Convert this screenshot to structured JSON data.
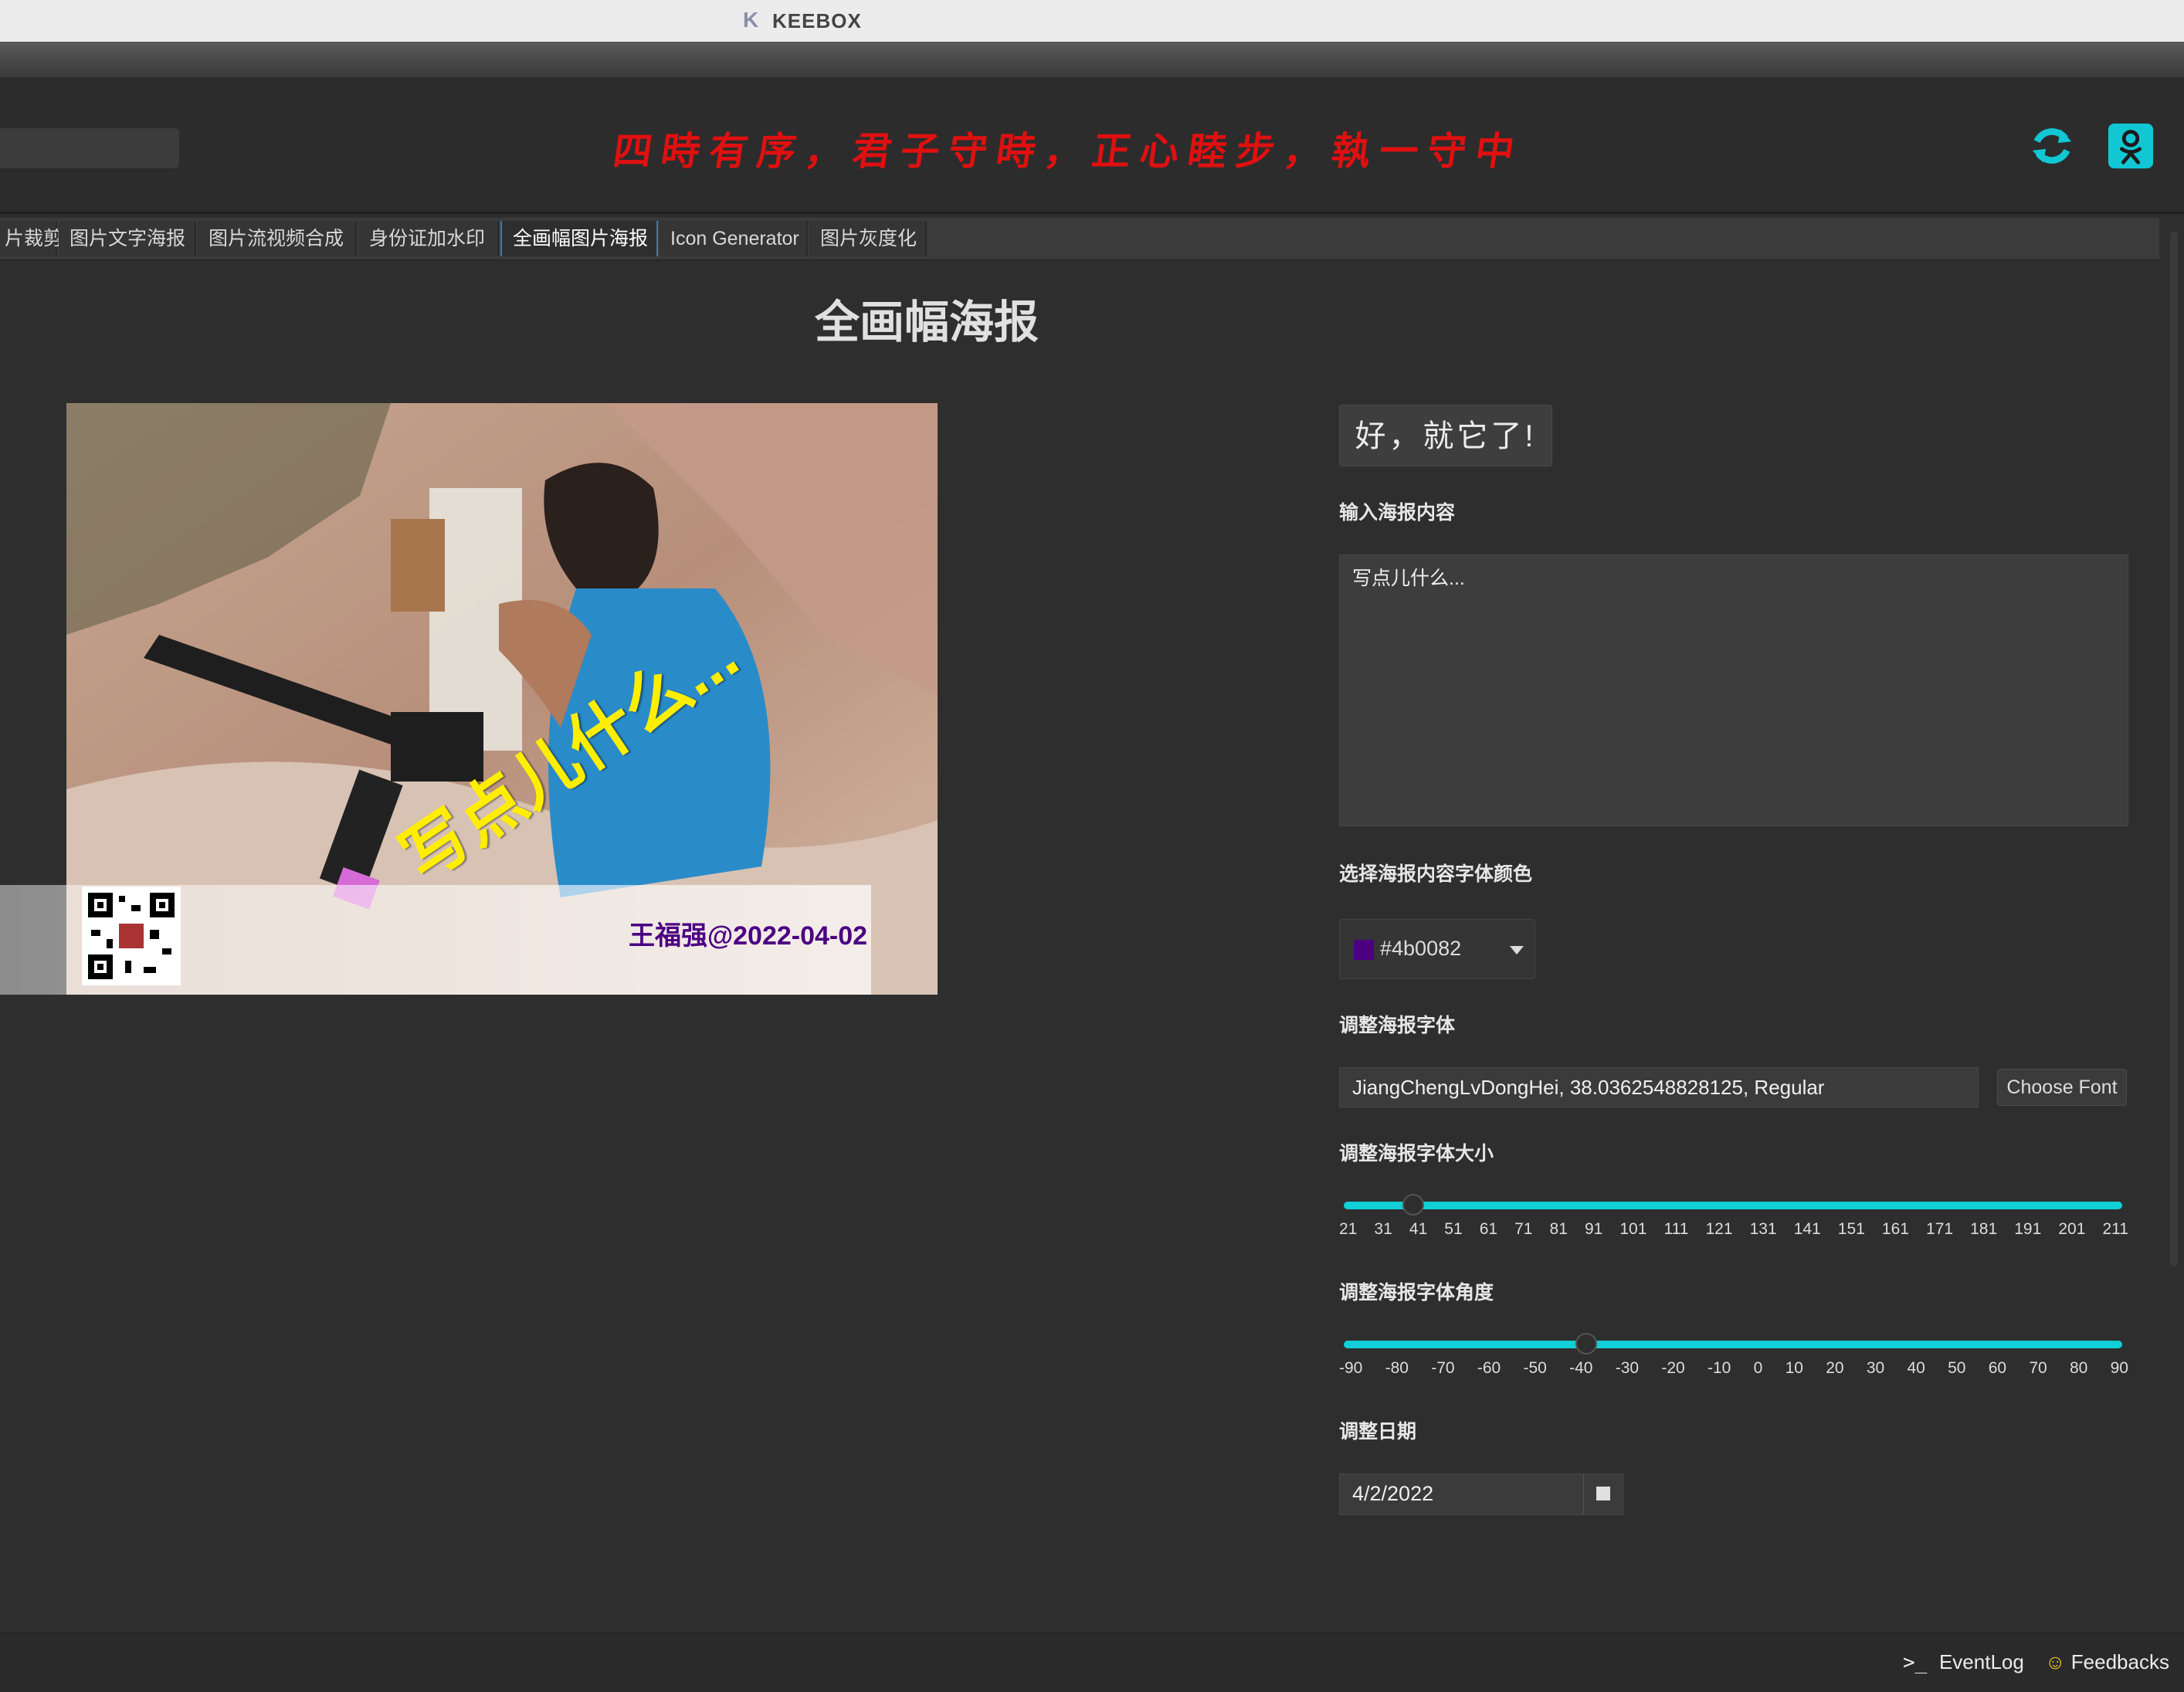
{
  "window": {
    "title": "KEEBOX",
    "logo_glyph": "K"
  },
  "header": {
    "slogan": "四時有序，君子守時，正心睦步，執一守中",
    "accent_color": "#e01010",
    "icons": [
      "refresh-icon",
      "ok-social-icon"
    ],
    "icon_color": "#11c7d4"
  },
  "tabs": [
    {
      "label": "片裁剪"
    },
    {
      "label": "图片文字海报"
    },
    {
      "label": "图片流视频合成"
    },
    {
      "label": "身份证加水印"
    },
    {
      "label": "全画幅图片海报",
      "active": true
    },
    {
      "label": "Icon Generator"
    },
    {
      "label": "图片灰度化"
    }
  ],
  "page": {
    "title": "全画幅海报"
  },
  "poster": {
    "overlay_text": "写点儿什么...",
    "overlay_color": "#ffee00",
    "signature": "王福强@2022-04-02"
  },
  "form": {
    "submit_label": "好，就它了!",
    "content_label": "输入海报内容",
    "content_value": "写点儿什么...",
    "color_label": "选择海报内容字体颜色",
    "color_value": "#4b0082",
    "font_label": "调整海报字体",
    "font_value": "JiangChengLvDongHei, 38.0362548828125, Regular",
    "choose_font_label": "Choose Font",
    "size_label": "调整海报字体大小",
    "size_ticks": [
      "21",
      "31",
      "41",
      "51",
      "61",
      "71",
      "81",
      "91",
      "101",
      "111",
      "121",
      "131",
      "141",
      "151",
      "161",
      "171",
      "181",
      "191",
      "201",
      "211"
    ],
    "size_value": 38.04,
    "size_range": [
      21,
      211
    ],
    "angle_label": "调整海报字体角度",
    "angle_ticks": [
      "-90",
      "-80",
      "-70",
      "-60",
      "-50",
      "-40",
      "-30",
      "-20",
      "-10",
      "0",
      "10",
      "20",
      "30",
      "40",
      "50",
      "60",
      "70",
      "80",
      "90"
    ],
    "angle_value": -34,
    "angle_range": [
      -90,
      90
    ],
    "slider_color": "#10cfd6",
    "date_label": "调整日期",
    "date_value": "4/2/2022"
  },
  "statusbar": {
    "eventlog_label": "EventLog",
    "feedback_label": "Feedbacks"
  }
}
